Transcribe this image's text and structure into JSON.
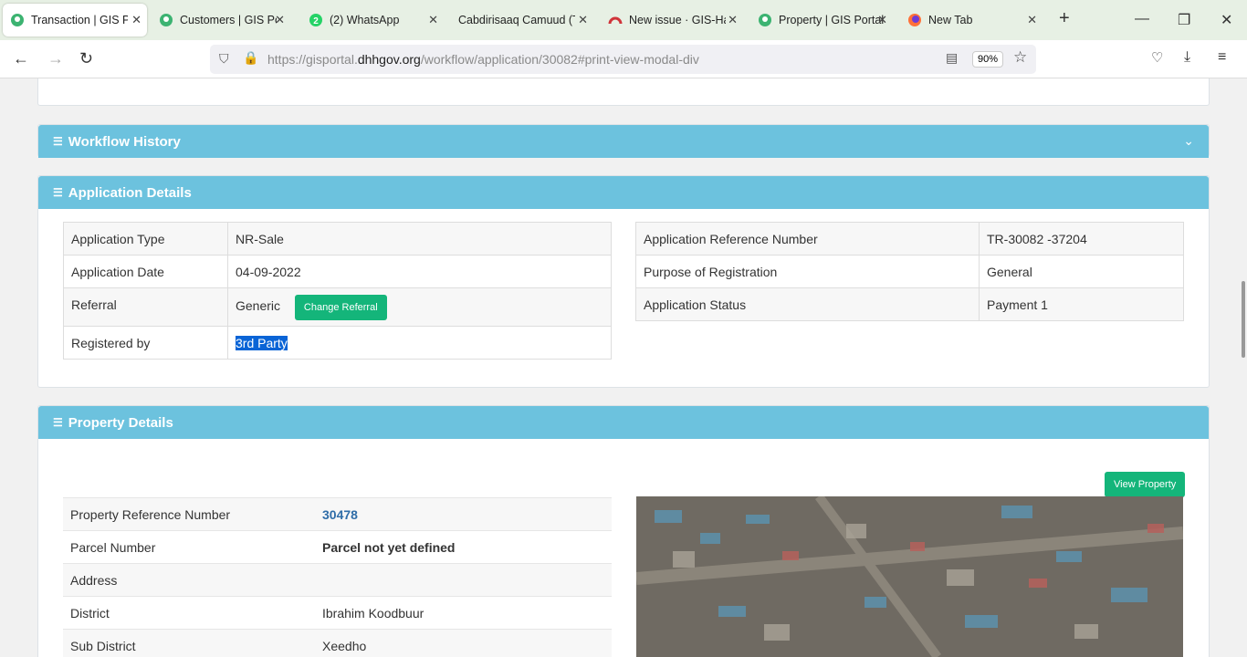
{
  "browser": {
    "tabs": [
      {
        "title": "Transaction | GIS Portal"
      },
      {
        "title": "Customers | GIS Portal"
      },
      {
        "title": "(2) WhatsApp",
        "badge": "2"
      },
      {
        "title": "Cabdirisaaq Camuud (To"
      },
      {
        "title": "New issue · GIS-Har"
      },
      {
        "title": "Property | GIS Portal"
      },
      {
        "title": "New Tab"
      }
    ],
    "url_prefix": "https://gisportal.",
    "url_domain": "dhhgov.org",
    "url_path": "/workflow/application/30082#print-view-modal-div",
    "zoom": "90%"
  },
  "sections": {
    "workflow_history": "Workflow History",
    "application_details": "Application Details",
    "property_details": "Property Details"
  },
  "application": {
    "left": [
      {
        "label": "Application Type",
        "value": "NR-Sale"
      },
      {
        "label": "Application Date",
        "value": "04-09-2022"
      },
      {
        "label": "Referral",
        "value": "Generic",
        "button": "Change Referral"
      },
      {
        "label": "Registered by",
        "value": "3rd Party"
      }
    ],
    "right": [
      {
        "label": "Application Reference Number",
        "value": "TR-30082 -37204"
      },
      {
        "label": "Purpose of Registration",
        "value": "General"
      },
      {
        "label": "Application Status",
        "value": "Payment 1"
      }
    ]
  },
  "property": {
    "view_button": "View Property",
    "rows": [
      {
        "label": "Property Reference Number",
        "value": "30478"
      },
      {
        "label": "Parcel Number",
        "value": "Parcel not yet defined"
      },
      {
        "label": "Address",
        "value": ""
      },
      {
        "label": "District",
        "value": "Ibrahim Koodbuur"
      },
      {
        "label": "Sub District",
        "value": "Xeedho"
      }
    ]
  },
  "colors": {
    "section_header": "#6cc2de",
    "button_green": "#14b57a",
    "selection": "#0a64d6",
    "link": "#2f6da8"
  }
}
